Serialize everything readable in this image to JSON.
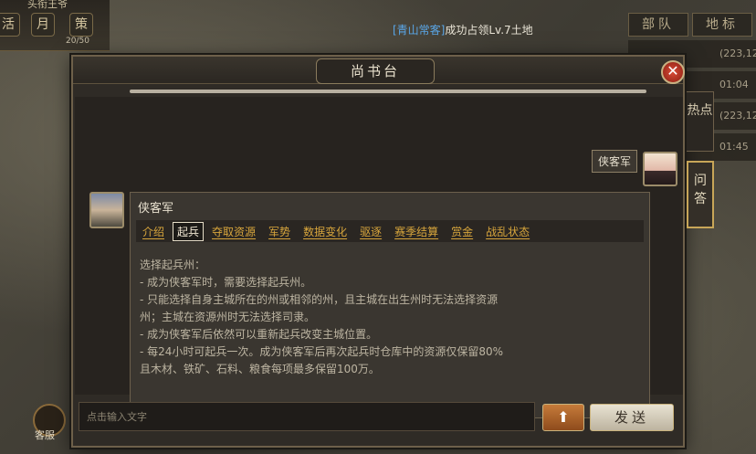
{
  "hud": {
    "top_title": "头衔王爷",
    "mini_buttons": [
      "活",
      "月",
      "策"
    ],
    "mini_count": "20/50",
    "notice_who": "[青山常客]",
    "notice_text": "成功占领Lv.7土地",
    "right_tabs": [
      "部队",
      "地标"
    ],
    "right_rows": [
      "(223,12",
      "01:04",
      "(223,12",
      "01:45"
    ],
    "cs_label": "客服"
  },
  "dialog": {
    "title": "尚书台",
    "close_icon": "close-icon",
    "user": {
      "name": "侠客军"
    },
    "bot": {
      "name": "侠客军",
      "tabs": [
        {
          "label": "介绍",
          "active": false
        },
        {
          "label": "起兵",
          "active": true
        },
        {
          "label": "夺取资源",
          "active": false
        },
        {
          "label": "军势",
          "active": false
        },
        {
          "label": "数据变化",
          "active": false
        },
        {
          "label": "驱逐",
          "active": false
        },
        {
          "label": "赛季结算",
          "active": false
        },
        {
          "label": "赏金",
          "active": false
        },
        {
          "label": "战乱状态",
          "active": false
        }
      ],
      "content": [
        "选择起兵州：",
        "- 成为侠客军时，需要选择起兵州。",
        "- 只能选择自身主城所在的州或相邻的州，且主城在出生州时无法选择资源",
        "州；主城在资源州时无法选择司隶。",
        "- 成为侠客军后依然可以重新起兵改变主城位置。",
        "- 每24小时可起兵一次。成为侠客军后再次起兵时仓库中的资源仅保留80%",
        "且木材、铁矿、石料、粮食每项最多保留100万。"
      ]
    },
    "input_placeholder": "点击输入文字",
    "up_icon": "arrow-up-icon",
    "send_label": "发送"
  },
  "side_tabs": [
    "热点",
    "问答"
  ],
  "colors": {
    "tab_link": "#d7a53c",
    "accent_gold": "#c8a658",
    "close_red": "#c0392b"
  }
}
